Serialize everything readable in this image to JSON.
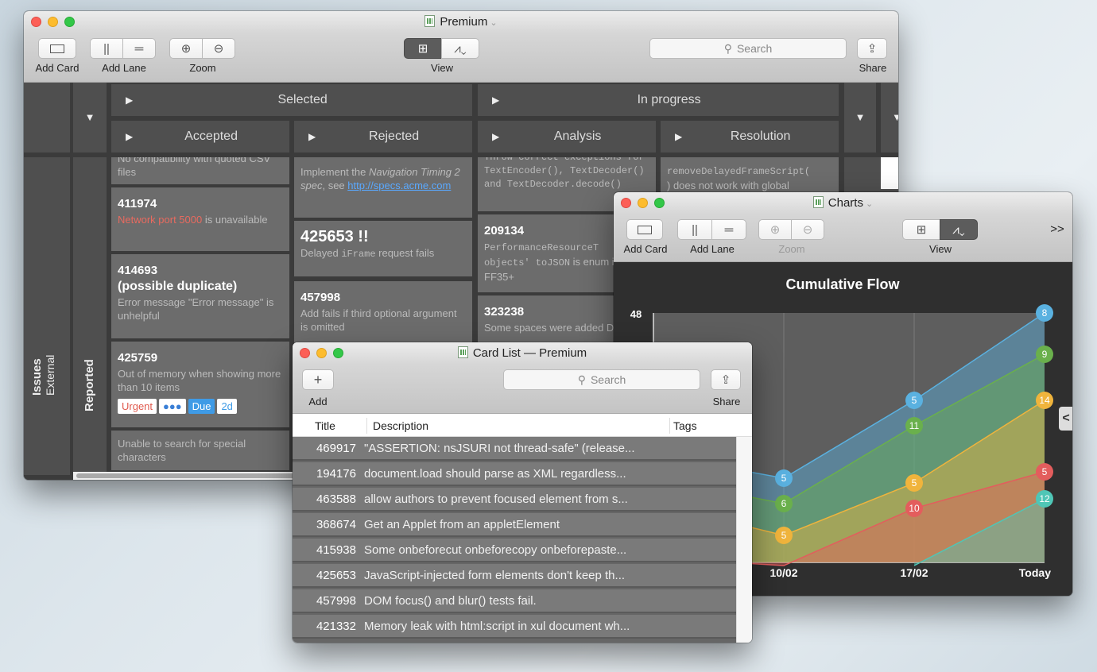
{
  "main_window": {
    "title": "Premium",
    "toolbar": {
      "add_card": "Add Card",
      "add_lane": "Add Lane",
      "zoom": "Zoom",
      "view": "View",
      "search_placeholder": "Search",
      "share": "Share"
    },
    "groups": {
      "selected": "Selected",
      "in_progress": "In progress"
    },
    "lanes": {
      "accepted": "Accepted",
      "rejected": "Rejected",
      "analysis": "Analysis",
      "resolution": "Resolution"
    },
    "row_header": {
      "issues": "Issues",
      "external": "External",
      "reported": "Reported"
    },
    "accepted_cards": [
      {
        "text": "No compatibility with quoted CSV files"
      },
      {
        "id": "411974",
        "red": "Network port 5000",
        "rest": " is unavailable"
      },
      {
        "id": "414693",
        "id2": "(possible duplicate)",
        "desc": "Error message \"Error message\" is unhelpful"
      },
      {
        "id": "425759",
        "desc": "Out of memory when showing more than 10 items",
        "tags": [
          "Urgent",
          "●●●",
          "Due",
          "2d"
        ]
      },
      {
        "desc": "Unable to search for special characters"
      }
    ],
    "rejected_cards": [
      {
        "pre": "Implement the ",
        "em": "Navigation Timing 2 spec",
        "mid": ", see ",
        "link": "http://specs.acme.com"
      },
      {
        "id": "425653 !!",
        "pre": "Delayed ",
        "code": "iFrame",
        "post": " request fails"
      },
      {
        "id": "457998",
        "desc": "Add fails if third optional argument is omitted"
      }
    ],
    "analysis_cards": [
      {
        "code": "Throw correct exceptions for TextEncoder(), TextDecoder() and TextDecoder.decode()"
      },
      {
        "id": "209134",
        "code": "PerformanceResourceT",
        "code2": "objects' toJSON",
        "desc": " is enum in FF35+"
      },
      {
        "id": "323238",
        "desc": "Some spaces were added DOM"
      }
    ],
    "resolution_cards": [
      {
        "code": "removeDelayedFrameScript(",
        "desc": ") does not work with global"
      }
    ]
  },
  "charts_window": {
    "title": "Charts",
    "toolbar": {
      "add_card": "Add Card",
      "add_lane": "Add Lane",
      "zoom": "Zoom",
      "view": "View",
      "overflow": ">>"
    },
    "nav_arrow": "<"
  },
  "chart_data": {
    "type": "area",
    "title": "Cumulative Flow",
    "x": [
      "10/02",
      "17/02",
      "Today"
    ],
    "ylim": [
      0,
      48
    ],
    "y_tick_labels": [
      "48"
    ],
    "series": [
      {
        "color": "#5ab1e0",
        "values": [
          null,
          5,
          8
        ]
      },
      {
        "color": "#6ab04c",
        "values": [
          6,
          11,
          9
        ]
      },
      {
        "color": "#f0b43c",
        "values": [
          5,
          5,
          14
        ]
      },
      {
        "color": "#e35d5d",
        "values": [
          null,
          10,
          5
        ]
      },
      {
        "color": "#4fc6b6",
        "values": [
          null,
          null,
          12
        ]
      }
    ]
  },
  "card_list_window": {
    "title": "Card List — Premium",
    "toolbar": {
      "add": "Add",
      "search_placeholder": "Search",
      "share": "Share"
    },
    "columns": [
      "Title",
      "Description",
      "Tags"
    ],
    "rows": [
      {
        "title": "469917",
        "desc": "\"ASSERTION: nsJSURI not thread-safe\" (release..."
      },
      {
        "title": "194176",
        "desc": "document.load should parse as XML regardless..."
      },
      {
        "title": "463588",
        "desc": "allow authors to prevent focused element from s..."
      },
      {
        "title": "368674",
        "desc": "Get an Applet from an appletElement"
      },
      {
        "title": "415938",
        "desc": "Some onbeforecut onbeforecopy onbeforepaste..."
      },
      {
        "title": "425653",
        "desc": "JavaScript-injected form elements don't keep th..."
      },
      {
        "title": "457998",
        "desc": "DOM focus() and blur() tests fail."
      },
      {
        "title": "421332",
        "desc": "Memory leak with html:script in xul document wh..."
      }
    ]
  }
}
